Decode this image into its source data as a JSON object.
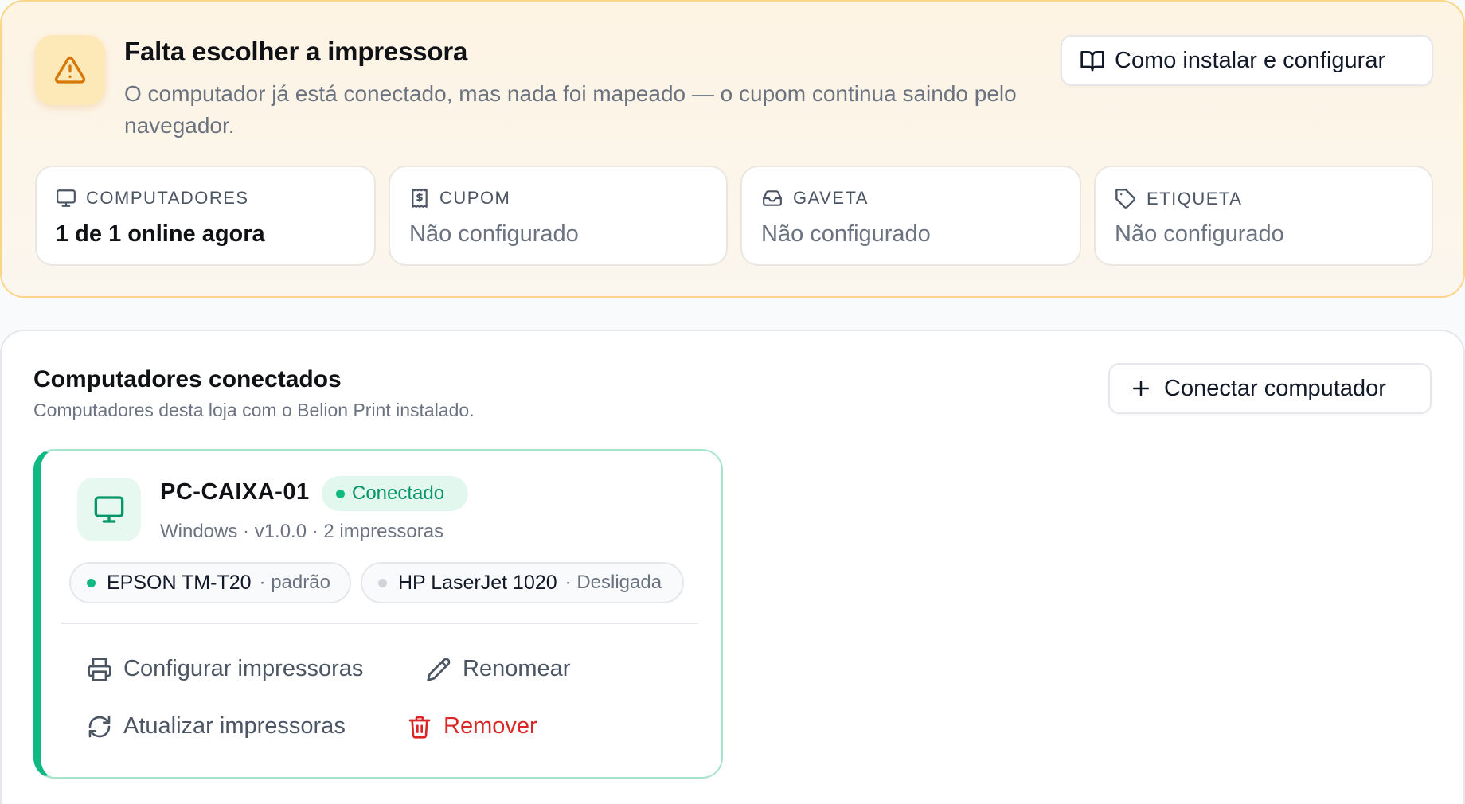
{
  "alert": {
    "icon": "alert-triangle-icon",
    "title": "Falta escolher a impressora",
    "description": "O computador já está conectado, mas nada foi mapeado — o cupom continua saindo pelo navegador.",
    "guide_button": "Como instalar e configurar"
  },
  "stats": [
    {
      "icon": "monitor-icon",
      "label": "COMPUTADORES",
      "value": "1 de 1 online agora"
    },
    {
      "icon": "receipt-icon",
      "label": "CUPOM",
      "value": "Não configurado"
    },
    {
      "icon": "drawer-icon",
      "label": "GAVETA",
      "value": "Não configurado"
    },
    {
      "icon": "tag-icon",
      "label": "ETIQUETA",
      "value": "Não configurado"
    }
  ],
  "computers": {
    "title": "Computadores conectados",
    "subtitle": "Computadores desta loja com o Belion Print instalado.",
    "connect_button": "Conectar computador",
    "device": {
      "name": "PC-CAIXA-01",
      "status": "Conectado",
      "meta": "Windows · v1.0.0 · 2 impressoras",
      "printers": [
        {
          "name": "EPSON TM-T20",
          "note": "· padrão",
          "status_color": "#10b981"
        },
        {
          "name": "HP LaserJet 1020",
          "note": "· Desligada",
          "status_color": "#d1d5db"
        }
      ],
      "actions": {
        "configure": "Configurar impressoras",
        "rename": "Renomear",
        "refresh": "Atualizar impressoras",
        "remove": "Remover"
      }
    }
  },
  "colors": {
    "warning_accent": "#d97706",
    "success": "#10b981",
    "danger": "#dc2626"
  }
}
